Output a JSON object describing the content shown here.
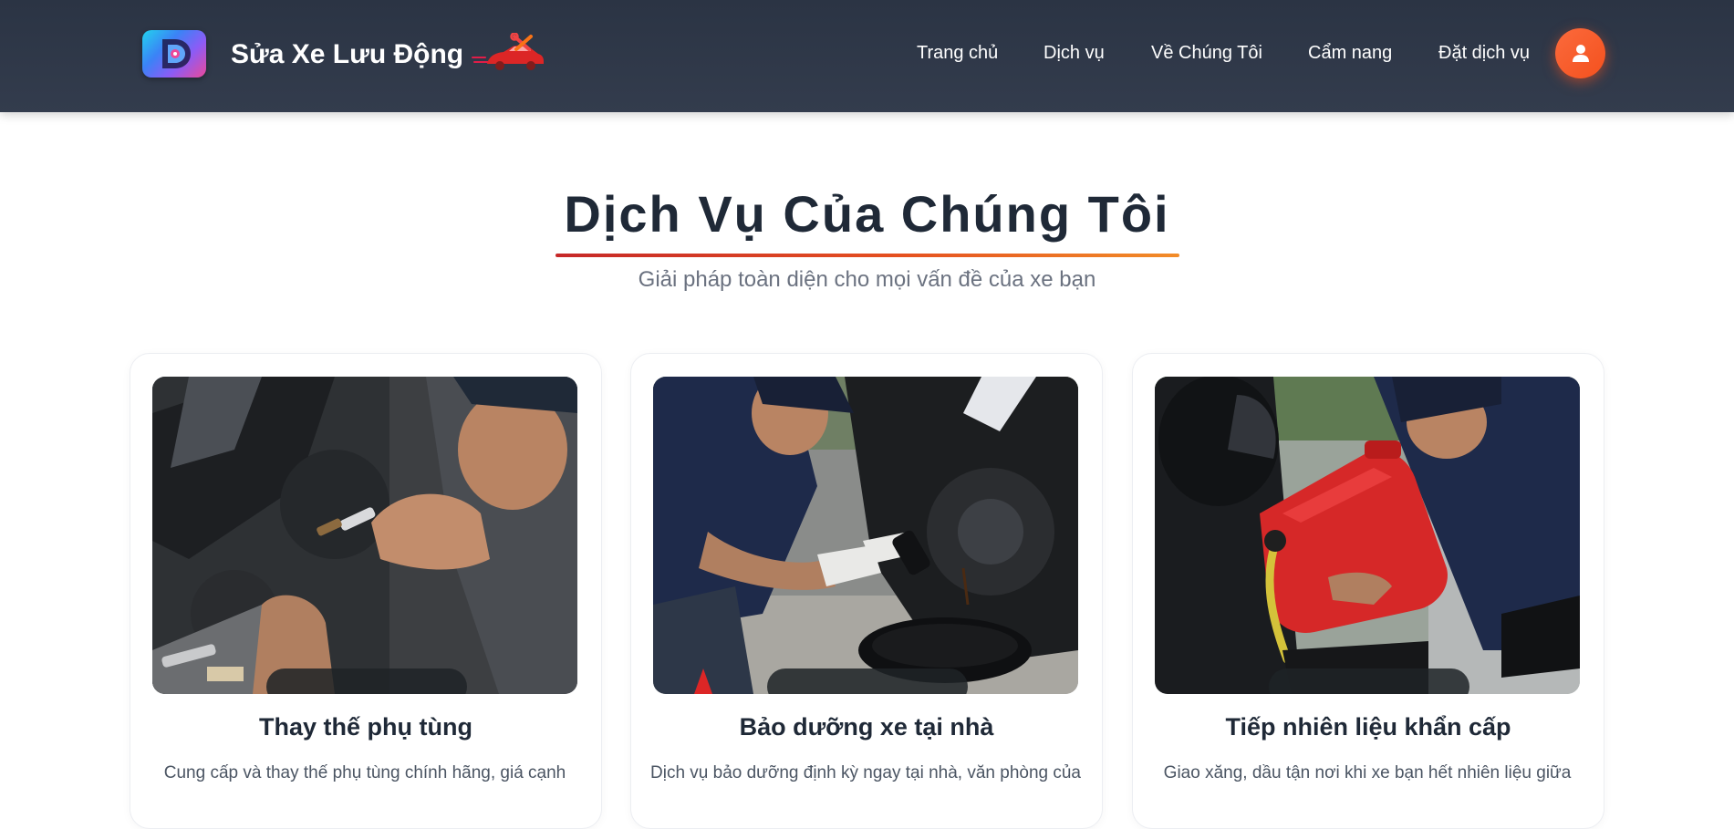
{
  "brand": {
    "name": "Sửa Xe Lưu Động",
    "logo_icon": "app-logo-icon",
    "car_icon": "red-car-wrench-icon"
  },
  "nav": {
    "items": [
      {
        "label": "Trang chủ"
      },
      {
        "label": "Dịch vụ"
      },
      {
        "label": "Về Chúng Tôi"
      },
      {
        "label": "Cẩm nang"
      },
      {
        "label": "Đặt dịch vụ"
      }
    ],
    "user_icon": "user-icon"
  },
  "section": {
    "title": "Dịch Vụ Của Chúng Tôi",
    "subtitle": "Giải pháp toàn diện cho mọi vấn đề của xe bạn"
  },
  "cards": [
    {
      "title": "Thay thế phụ tùng",
      "description": "Cung cấp và thay thế phụ tùng chính hãng, giá cạnh"
    },
    {
      "title": "Bảo dưỡng xe tại nhà",
      "description": "Dịch vụ bảo dưỡng định kỳ ngay tại nhà, văn phòng của"
    },
    {
      "title": "Tiếp nhiên liệu khẩn cấp",
      "description": "Giao xăng, dầu tận nơi khi xe bạn hết nhiên liệu giữa"
    }
  ],
  "colors": {
    "header_bg": "#2b3444",
    "accent": "#f4511e",
    "title_text": "#1f2937",
    "subtitle_text": "#6b7280"
  }
}
